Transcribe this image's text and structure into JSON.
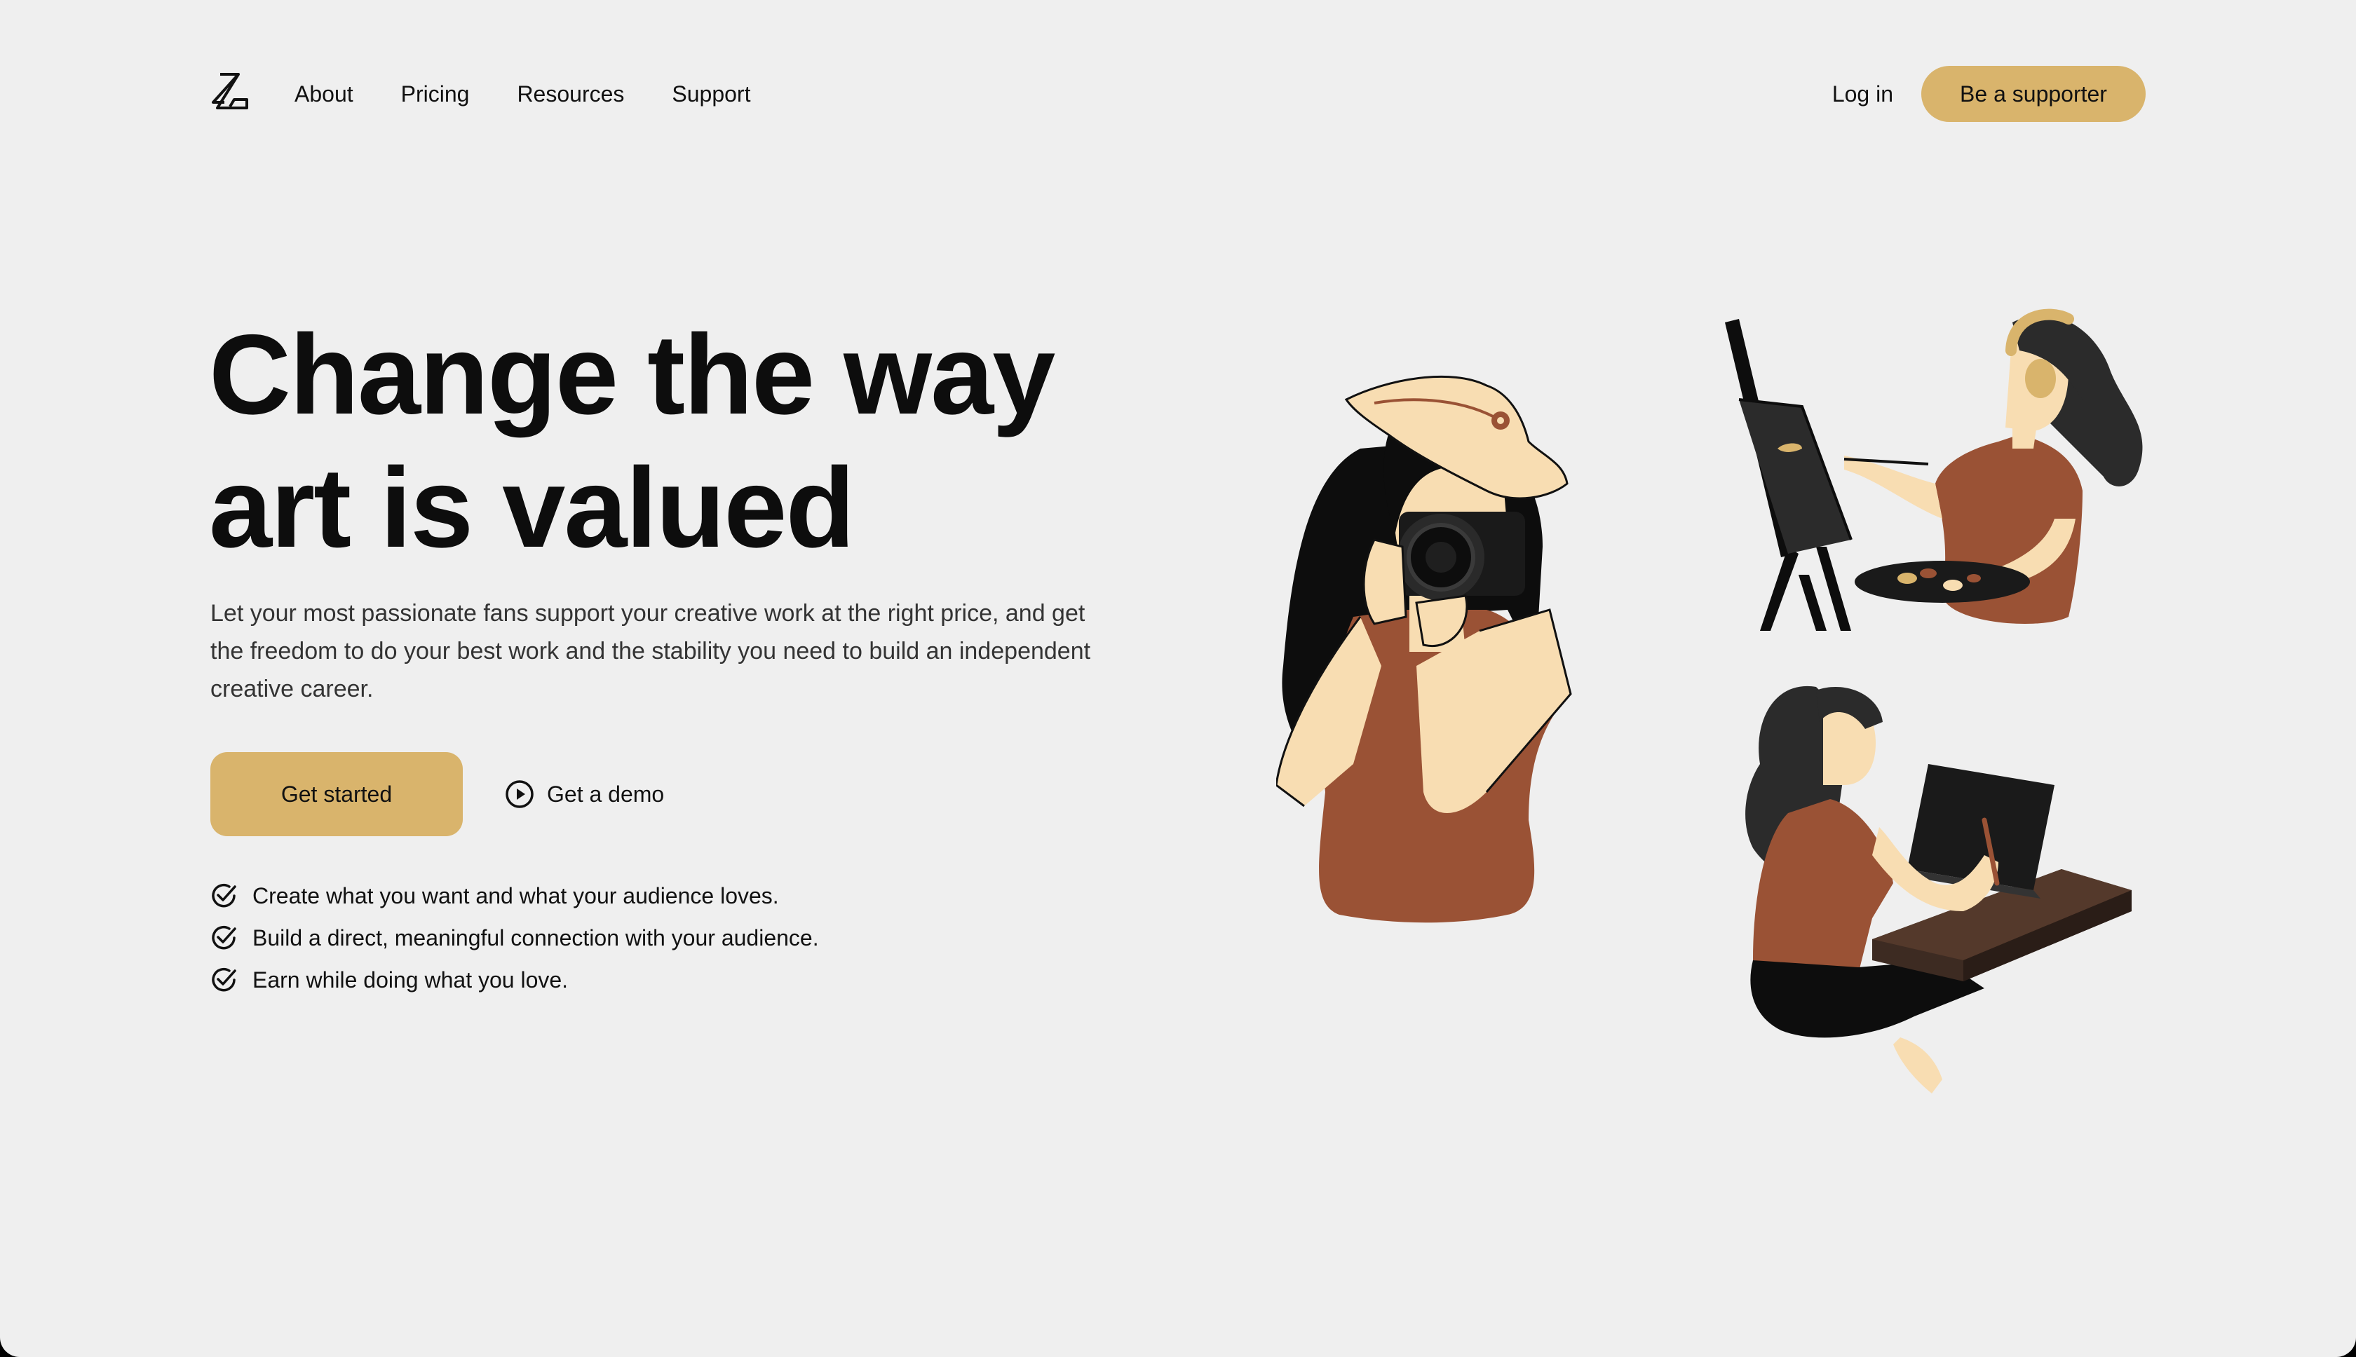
{
  "nav": {
    "logo_icon": "lightning-z-logo-icon",
    "links": [
      "About",
      "Pricing",
      "Resources",
      "Support"
    ],
    "login": "Log in",
    "supporter_button": "Be a supporter"
  },
  "hero": {
    "headline_line1": "Change the way",
    "headline_line2": "art is valued",
    "subtext": "Let your most passionate fans support your creative work at the right price, and get the freedom to do your best work and the stability you need to build an independent creative career.",
    "primary_cta": "Get started",
    "demo_cta": "Get a demo",
    "demo_icon": "play-circle-icon",
    "benefits": [
      "Create what you want and what your audience loves.",
      "Build a direct, meaningful connection with your audience.",
      "Earn while doing what you love."
    ],
    "benefit_icon": "check-circle-icon"
  },
  "colors": {
    "background": "#efefef",
    "accent": "#d9b46c",
    "text": "#0d0d0d",
    "shirt": "#9a5235",
    "skin": "#f8ddb2",
    "hair": "#2b2b2b"
  },
  "illustrations": [
    "photographer-illustration",
    "painter-illustration",
    "tablet-artist-illustration"
  ]
}
